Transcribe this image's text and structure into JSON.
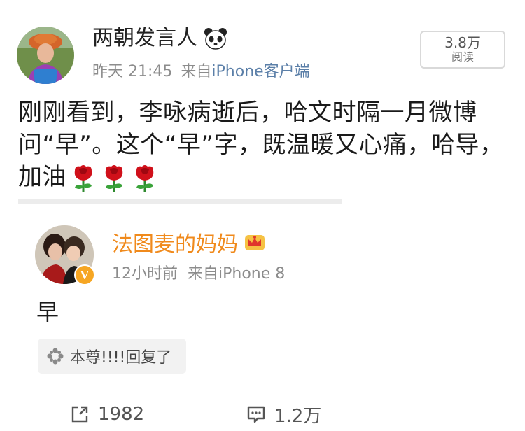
{
  "post": {
    "author": "两朝发言人",
    "author_badge_icon": "panda-icon",
    "time": "昨天 21:45",
    "source_prefix": "来自",
    "source_device": "iPhone客户端",
    "read_count": "3.8万",
    "read_label": "阅读",
    "body_lines": [
      "刚刚看到，李咏病逝后，哈文时隔一月微博",
      "问“早”。这个“早”字，既温暖又心痛，哈导，",
      "加油"
    ],
    "body_emoji": [
      "rose-icon",
      "rose-icon",
      "rose-icon"
    ]
  },
  "reply": {
    "author": "法图麦的妈妈",
    "author_badge_icon": "crown-icon",
    "verified_badge": "V",
    "time": "12小时前",
    "source": "来自iPhone 8",
    "text": "早",
    "chip_icon": "flower-icon",
    "chip_text": "本尊!!!!回复了"
  },
  "footer": {
    "repost_icon": "repost-icon",
    "repost_count": "1982",
    "comment_icon": "comment-icon",
    "comment_count": "1.2万"
  },
  "colors": {
    "reply_author": "#f08a1c",
    "device_link": "#5b7fa8",
    "meta_gray": "#8c8c8c",
    "rose_red": "#d0101a"
  }
}
